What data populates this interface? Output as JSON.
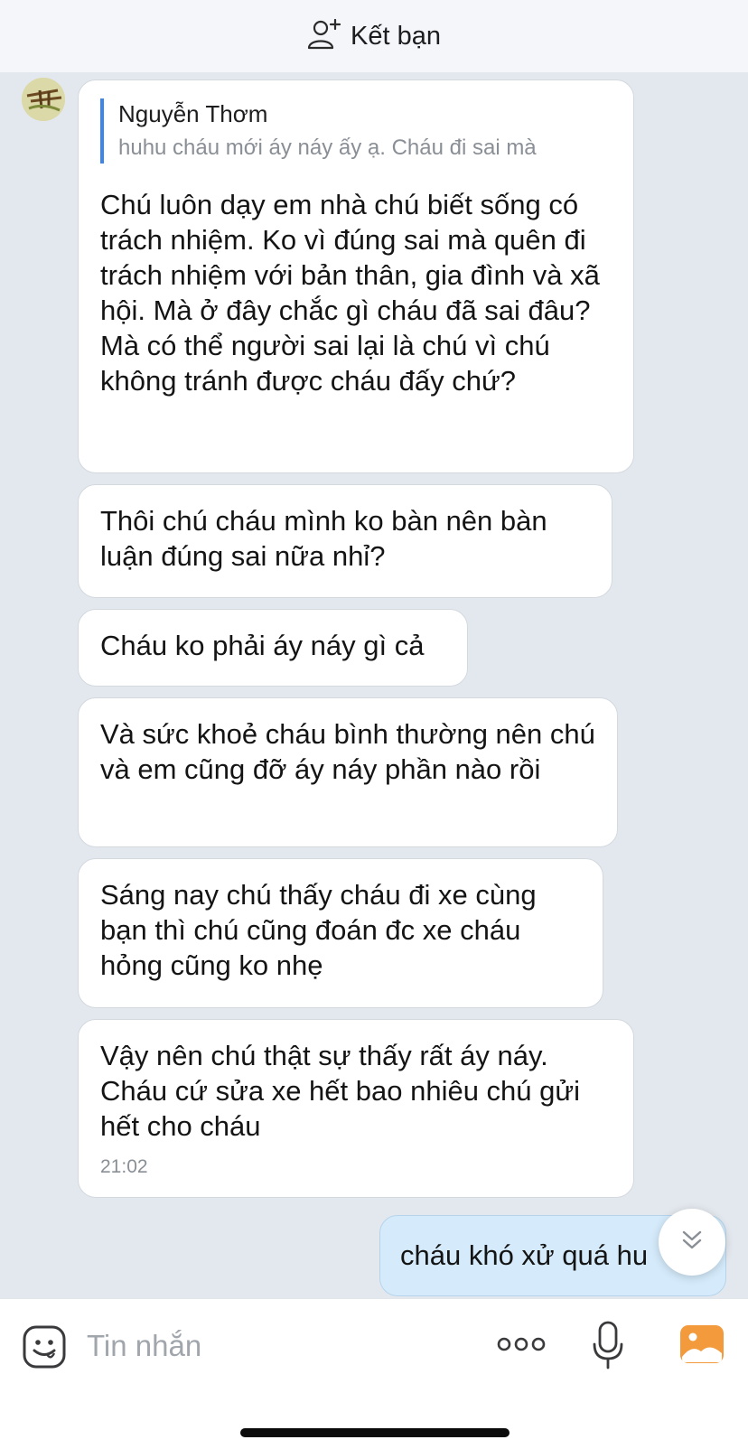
{
  "header": {
    "add_friend_label": "Kết bạn"
  },
  "messages": [
    {
      "quote_name": "Nguyễn Thơm",
      "quote_text": "huhu cháu mới áy náy ấy ạ. Cháu đi sai mà",
      "text": "Chú luôn dạy em nhà chú biết sống có trách nhiệm. Ko vì đúng sai mà quên đi trách nhiệm với bản thân, gia đình và xã hội. Mà ở đây chắc gì cháu đã sai đâu? Mà có thể người sai lại là chú vì chú không tránh được cháu đấy chứ?"
    },
    {
      "text": "Thôi chú cháu mình ko bàn nên bàn luận đúng sai nữa nhỉ?"
    },
    {
      "text": "Cháu ko phải áy náy gì cả"
    },
    {
      "text": "Và sức khoẻ cháu bình thường nên chú và em cũng đỡ áy náy phần nào rồi"
    },
    {
      "text": "Sáng nay chú thấy cháu đi xe cùng bạn thì chú cũng đoán đc xe cháu hỏng cũng ko nhẹ"
    },
    {
      "text": "Vậy nên chú thật sự thấy rất áy náy. Cháu cứ sửa xe hết bao nhiêu chú gửi hết cho cháu",
      "time": "21:02"
    }
  ],
  "outgoing": {
    "text": "cháu khó xử quá hu"
  },
  "composer": {
    "placeholder": "Tin nhắn"
  },
  "icons": {
    "add_friend": "person-plus-icon",
    "scroll": "chevron-double-down-icon",
    "emoji": "emoji-icon",
    "more": "more-dots-icon",
    "mic": "microphone-icon",
    "image": "image-icon"
  },
  "colors": {
    "background": "#e3e8ee",
    "quote_bar": "#3d86e8",
    "outgoing_bubble": "#d5ebfb",
    "image_icon": "#f29a3c"
  }
}
